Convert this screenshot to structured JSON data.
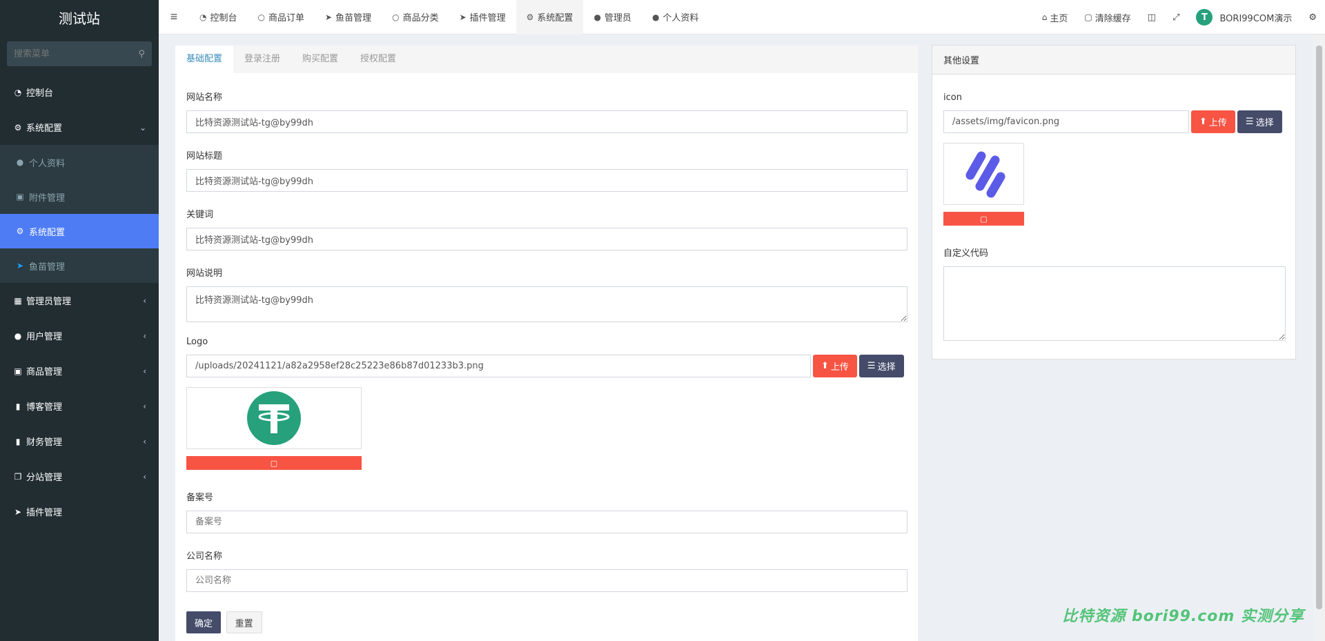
{
  "brand": "测试站",
  "sidebar": {
    "search_placeholder": "搜索菜单",
    "items": [
      {
        "label": "控制台"
      },
      {
        "label": "系统配置"
      },
      {
        "label": "个人资料"
      },
      {
        "label": "附件管理"
      },
      {
        "label": "系统配置"
      },
      {
        "label": "鱼苗管理"
      },
      {
        "label": "管理员管理"
      },
      {
        "label": "用户管理"
      },
      {
        "label": "商品管理"
      },
      {
        "label": "博客管理"
      },
      {
        "label": "财务管理"
      },
      {
        "label": "分站管理"
      },
      {
        "label": "插件管理"
      }
    ]
  },
  "topnav": {
    "tabs": [
      {
        "label": "控制台"
      },
      {
        "label": "商品订单"
      },
      {
        "label": "鱼苗管理"
      },
      {
        "label": "商品分类"
      },
      {
        "label": "插件管理"
      },
      {
        "label": "系统配置"
      },
      {
        "label": "管理员"
      },
      {
        "label": "个人资料"
      }
    ],
    "home": "主页",
    "clear_cache": "清除缓存",
    "user": "BORI99COM演示"
  },
  "config_tabs": [
    "基础配置",
    "登录注册",
    "购买配置",
    "授权配置"
  ],
  "form": {
    "site_name_label": "网站名称",
    "site_name": "比特资源测试站-tg@by99dh",
    "site_title_label": "网站标题",
    "site_title": "比特资源测试站-tg@by99dh",
    "keywords_label": "关键词",
    "keywords": "比特资源测试站-tg@by99dh",
    "description_label": "网站说明",
    "description": "比特资源测试站-tg@by99dh",
    "logo_label": "Logo",
    "logo_path": "/uploads/20241121/a82a2958ef28c25223e86b87d01233b3.png",
    "upload_label": "上传",
    "select_label": "选择",
    "icp_label": "备案号",
    "icp_placeholder": "备案号",
    "company_label": "公司名称",
    "company_placeholder": "公司名称",
    "submit": "确定",
    "reset": "重置"
  },
  "other": {
    "title": "其他设置",
    "icon_label": "icon",
    "icon_path": "/assets/img/favicon.png",
    "upload_label": "上传",
    "select_label": "选择",
    "custom_code_label": "自定义代码"
  },
  "watermark": "比特资源 bori99.com 实测分享",
  "colors": {
    "sidebar_bg": "#222d32",
    "active_blue": "#4d7cf5",
    "danger": "#f75444",
    "navy": "#444c69",
    "tether_green": "#26a17b"
  }
}
